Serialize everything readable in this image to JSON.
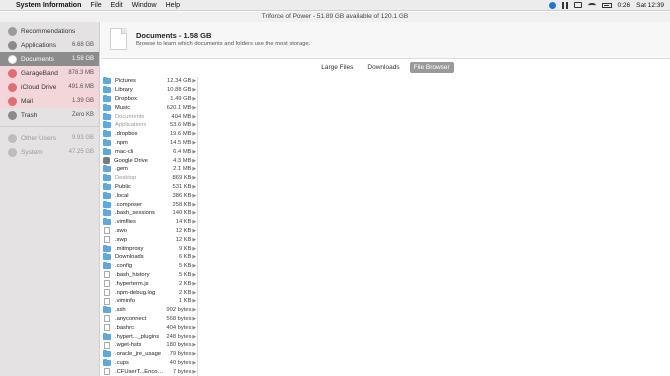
{
  "menubar": {
    "apple_glyph": "",
    "app_name": "System Information",
    "menus": [
      "File",
      "Edit",
      "Window",
      "Help"
    ],
    "right": {
      "clock": "Sat 12:39",
      "battery": "0:26"
    }
  },
  "window": {
    "title": "Triforce of Power - 51.89 GB available of 120.1 GB"
  },
  "sidebar": {
    "items": [
      {
        "label": "Recommendations",
        "size": "",
        "icon": "lightbulb-icon",
        "color": "#9c9c9c",
        "state": "normal"
      },
      {
        "label": "Applications",
        "size": "6.68 GB",
        "icon": "applications-icon",
        "color": "#8a8a8a",
        "state": "normal"
      },
      {
        "label": "Documents",
        "size": "1.58 GB",
        "icon": "documents-icon",
        "color": "#ffffff",
        "state": "selected"
      },
      {
        "label": "GarageBand",
        "size": "878.3 MB",
        "icon": "garageband-icon",
        "color": "#e66b73",
        "state": "pink"
      },
      {
        "label": "iCloud Drive",
        "size": "491.6 MB",
        "icon": "icloud-icon",
        "color": "#e66b73",
        "state": "pink"
      },
      {
        "label": "Mail",
        "size": "1.39 GB",
        "icon": "mail-icon",
        "color": "#e66b73",
        "state": "pink"
      },
      {
        "label": "Trash",
        "size": "Zero KB",
        "icon": "trash-icon",
        "color": "#8a8a8a",
        "state": "normal"
      },
      {
        "label": "Other Users",
        "size": "9.93 GB",
        "icon": "other-users-icon",
        "color": "#bdbdbd",
        "state": "dim"
      },
      {
        "label": "System",
        "size": "47.25 GB",
        "icon": "system-icon",
        "color": "#bdbdbd",
        "state": "dim"
      }
    ]
  },
  "header": {
    "title": "Documents - 1.58 GB",
    "description": "Browse to learn which documents and folders use the most storage."
  },
  "tabs": [
    "Large Files",
    "Downloads",
    "File Browser"
  ],
  "active_tab": "File Browser",
  "files": [
    {
      "name": "Pictures",
      "size": "12.34 GB",
      "type": "folder",
      "dim": false
    },
    {
      "name": "Library",
      "size": "10.88 GB",
      "type": "folder",
      "dim": false
    },
    {
      "name": "Dropbox",
      "size": "1.49 GB",
      "type": "folder",
      "dim": false
    },
    {
      "name": "Music",
      "size": "620.1 MB",
      "type": "folder",
      "dim": false
    },
    {
      "name": "Documents",
      "size": "404 MB",
      "type": "folder",
      "dim": true
    },
    {
      "name": "Applications",
      "size": "53.6 MB",
      "type": "folder",
      "dim": true
    },
    {
      "name": ".dropbox",
      "size": "19.6 MB",
      "type": "folder",
      "dim": false
    },
    {
      "name": ".npm",
      "size": "14.5 MB",
      "type": "folder",
      "dim": false
    },
    {
      "name": "mac-cli",
      "size": "6.4 MB",
      "type": "folder",
      "dim": false
    },
    {
      "name": "Google Drive",
      "size": "4.3 MB",
      "type": "app",
      "dim": false
    },
    {
      "name": ".gem",
      "size": "2.1 MB",
      "type": "folder",
      "dim": false
    },
    {
      "name": "Desktop",
      "size": "869 KB",
      "type": "folder",
      "dim": true
    },
    {
      "name": "Public",
      "size": "531 KB",
      "type": "folder",
      "dim": false
    },
    {
      "name": ".local",
      "size": "386 KB",
      "type": "folder",
      "dim": false
    },
    {
      "name": ".composer",
      "size": "258 KB",
      "type": "folder",
      "dim": false
    },
    {
      "name": ".bash_sessions",
      "size": "140 KB",
      "type": "folder",
      "dim": false
    },
    {
      "name": ".vimfiles",
      "size": "14 KB",
      "type": "folder",
      "dim": false
    },
    {
      "name": ".swo",
      "size": "12 KB",
      "type": "file",
      "dim": false
    },
    {
      "name": ".swp",
      "size": "12 KB",
      "type": "file",
      "dim": false
    },
    {
      "name": ".mitmproxy",
      "size": "9 KB",
      "type": "folder",
      "dim": false
    },
    {
      "name": "Downloads",
      "size": "6 KB",
      "type": "folder",
      "dim": false
    },
    {
      "name": ".config",
      "size": "5 KB",
      "type": "folder",
      "dim": false
    },
    {
      "name": ".bash_history",
      "size": "5 KB",
      "type": "file",
      "dim": false
    },
    {
      "name": ".hyperterm.js",
      "size": "2 KB",
      "type": "file",
      "dim": false
    },
    {
      "name": ".npm-debug.log",
      "size": "2 KB",
      "type": "file",
      "dim": false
    },
    {
      "name": ".viminfo",
      "size": "1 KB",
      "type": "file",
      "dim": false
    },
    {
      "name": ".ssh",
      "size": "902 bytes",
      "type": "folder",
      "dim": false
    },
    {
      "name": ".anyconnect",
      "size": "568 bytes",
      "type": "file",
      "dim": false
    },
    {
      "name": ".bashrc",
      "size": "404 bytes",
      "type": "file",
      "dim": false
    },
    {
      "name": ".hypert..._plugins",
      "size": "248 bytes",
      "type": "folder",
      "dim": false
    },
    {
      "name": ".wget-hsts",
      "size": "180 bytes",
      "type": "file",
      "dim": false
    },
    {
      "name": ".oracle_jre_usage",
      "size": "79 bytes",
      "type": "folder",
      "dim": false
    },
    {
      "name": ".cups",
      "size": "40 bytes",
      "type": "folder",
      "dim": false
    },
    {
      "name": ".CFUserT...Encoding",
      "size": "7 bytes",
      "type": "file",
      "dim": false
    }
  ]
}
